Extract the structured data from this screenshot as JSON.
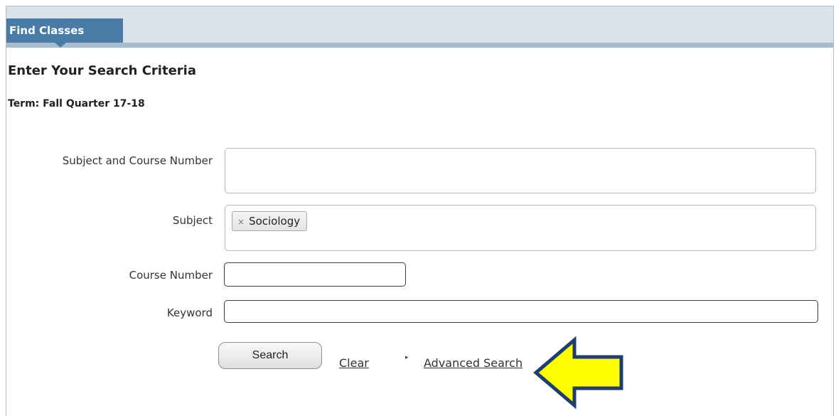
{
  "tab": {
    "label": "Find Classes"
  },
  "heading": "Enter Your Search Criteria",
  "term": "Term: Fall Quarter 17-18",
  "form": {
    "subject_course": {
      "label": "Subject and Course Number",
      "value": ""
    },
    "subject": {
      "label": "Subject",
      "chips": [
        {
          "remove_glyph": "×",
          "label": "Sociology"
        }
      ]
    },
    "course_number": {
      "label": "Course Number",
      "value": ""
    },
    "keyword": {
      "label": "Keyword",
      "value": ""
    }
  },
  "actions": {
    "search_label": "Search",
    "clear_label": "Clear",
    "advanced_caret": "▸",
    "advanced_label": "Advanced Search"
  },
  "annotation": {
    "icon": "left-arrow-icon",
    "fill": "#ffff00",
    "stroke": "#1f3e6e"
  },
  "colors": {
    "tab": "#4a7ba7",
    "tab_strip": "#d8e3ec",
    "tab_strip_border": "#a9bccb"
  }
}
